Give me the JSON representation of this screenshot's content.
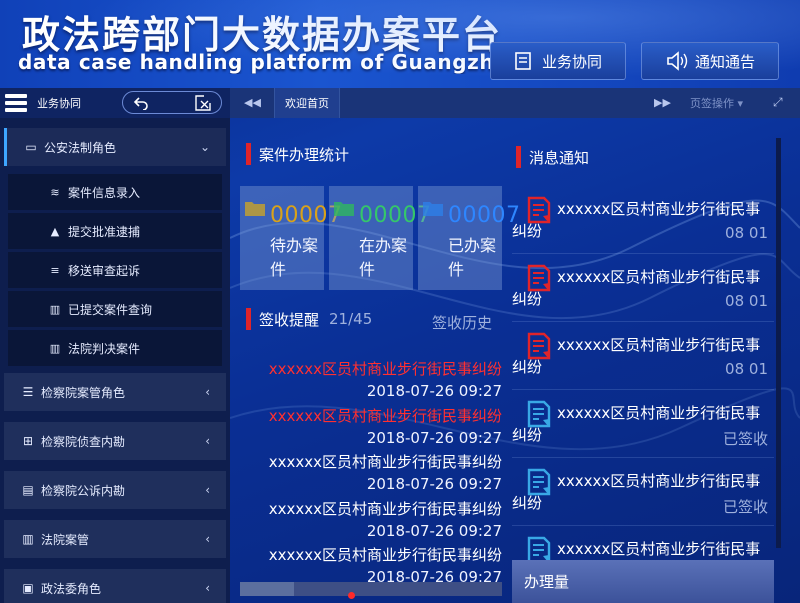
{
  "header": {
    "title_cn": "政法跨部门大数据办案平台",
    "title_en": "data case handling platform of Guangzhou politic",
    "btn_collab": "业务协同",
    "btn_notice": "通知通告"
  },
  "nav": {
    "side_label": "业务协同",
    "tab_home": "欢迎首页",
    "tab_ops": "页签操作"
  },
  "sidebar": {
    "roles": [
      {
        "label": "公安法制角色",
        "icon": "monitor-icon"
      },
      {
        "label": "检察院案管角色",
        "icon": "list-icon"
      },
      {
        "label": "检察院侦查内勘",
        "icon": "table-icon"
      },
      {
        "label": "检察院公诉内勘",
        "icon": "document-icon"
      },
      {
        "label": "法院案管",
        "icon": "bar-chart-icon"
      },
      {
        "label": "政法委角色",
        "icon": "briefcase-icon"
      }
    ],
    "subitems": [
      {
        "label": "案件信息录入",
        "icon": "rss-icon"
      },
      {
        "label": "提交批准逮捕",
        "icon": "warning-icon"
      },
      {
        "label": "移送审查起诉",
        "icon": "database-icon"
      },
      {
        "label": "已提交案件查询",
        "icon": "bar-chart-icon"
      },
      {
        "label": "法院判决案件",
        "icon": "bar-chart-icon"
      }
    ]
  },
  "stats": {
    "title": "案件办理统计",
    "items": [
      {
        "num": "00007",
        "label": "待办案件",
        "color": "#d9a21a"
      },
      {
        "num": "00007",
        "label": "在办案件",
        "color": "#35c76a"
      },
      {
        "num": "00007",
        "label": "已办案件",
        "color": "#2e86ff"
      }
    ]
  },
  "sign": {
    "title": "签收提醒",
    "count": "21/45",
    "history": "签收历史",
    "items": [
      {
        "title": "xxxxxx区员村商业步行街民事纠纷",
        "date": "2018-07-26 09:27",
        "hot": true
      },
      {
        "title": "xxxxxx区员村商业步行街民事纠纷",
        "date": "2018-07-26 09:27",
        "hot": true
      },
      {
        "title": "xxxxxx区员村商业步行街民事纠纷",
        "date": "2018-07-26 09:27",
        "hot": false
      },
      {
        "title": "xxxxxx区员村商业步行街民事纠纷",
        "date": "2018-07-26 09:27",
        "hot": false
      },
      {
        "title": "xxxxxx区员村商业步行街民事纠纷",
        "date": "2018-07-26 09:27",
        "hot": false
      }
    ]
  },
  "notices": {
    "title": "消息通知",
    "items": [
      {
        "title": "xxxxxx区员村商业步行街民事纠纷",
        "meta": "08 01",
        "unread": true
      },
      {
        "title": "xxxxxx区员村商业步行街民事纠纷",
        "meta": "08 01",
        "unread": true
      },
      {
        "title": "xxxxxx区员村商业步行街民事纠纷",
        "meta": "08 01",
        "unread": true
      },
      {
        "title": "xxxxxx区员村商业步行街民事纠纷",
        "meta": "已签收",
        "unread": false
      },
      {
        "title": "xxxxxx区员村商业步行街民事纠纷",
        "meta": "已签收",
        "unread": false
      },
      {
        "title": "xxxxxx区员村商业步行街民事纠纷",
        "meta": "",
        "unread": false
      }
    ],
    "volume_label": "办理量"
  }
}
